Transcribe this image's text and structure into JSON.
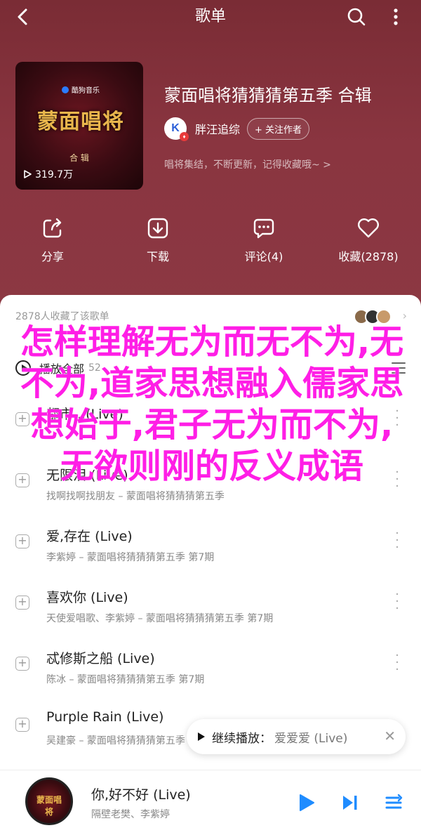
{
  "header": {
    "title": "歌单"
  },
  "album": {
    "cover_brand": "酷狗音乐",
    "cover_logo": "蒙面唱将",
    "cover_sub": "合 辑",
    "plays": "319.7万",
    "title": "蒙面唱将猜猜猜第五季 合辑",
    "artist": "胖汪追综",
    "follow_label": "+ 关注作者",
    "description": "唱将集结，不断更新，记得收藏哦~ >"
  },
  "actions": [
    {
      "label": "分享"
    },
    {
      "label": "下载"
    },
    {
      "label": "评论(4)"
    },
    {
      "label": "收藏(2878)"
    }
  ],
  "list": {
    "collect_text": "2878人收藏了该歌单",
    "playall_label": "播放全部",
    "playall_count": "52",
    "songs": [
      {
        "title": "都市...(Live)",
        "sub": ""
      },
      {
        "title": "无限泪 (Live)",
        "sub": "找啊找啊找朋友 – 蒙面唱将猜猜猜第五季"
      },
      {
        "title": "爱,存在 (Live)",
        "sub": "李紫婷 – 蒙面唱将猜猜猜第五季 第7期"
      },
      {
        "title": "喜欢你 (Live)",
        "sub": "天使爱唱歌、李紫婷 – 蒙面唱将猜猜猜第五季 第7期"
      },
      {
        "title": "忒修斯之船 (Live)",
        "sub": "陈冰 – 蒙面唱将猜猜猜第五季 第7期"
      },
      {
        "title": "Purple Rain (Live)",
        "sub": "吴建豪 – 蒙面唱将猜猜猜第五季"
      }
    ]
  },
  "resume": {
    "label": "继续播放：",
    "song": "爱爱爱 (Live)"
  },
  "player": {
    "disc_text": "蒙面唱将",
    "title": "你,好不好 (Live)",
    "artists": "隔壁老樊、李紫婷"
  },
  "overlay_text": "怎样理解无为而无不为,无不为,道家思想融入儒家思想始于,君子无为而不为,无欲则刚的反义成语",
  "colors": {
    "hero": "#8a3540",
    "overlay": "#ff1ee6",
    "accent_blue": "#1f8cff"
  }
}
